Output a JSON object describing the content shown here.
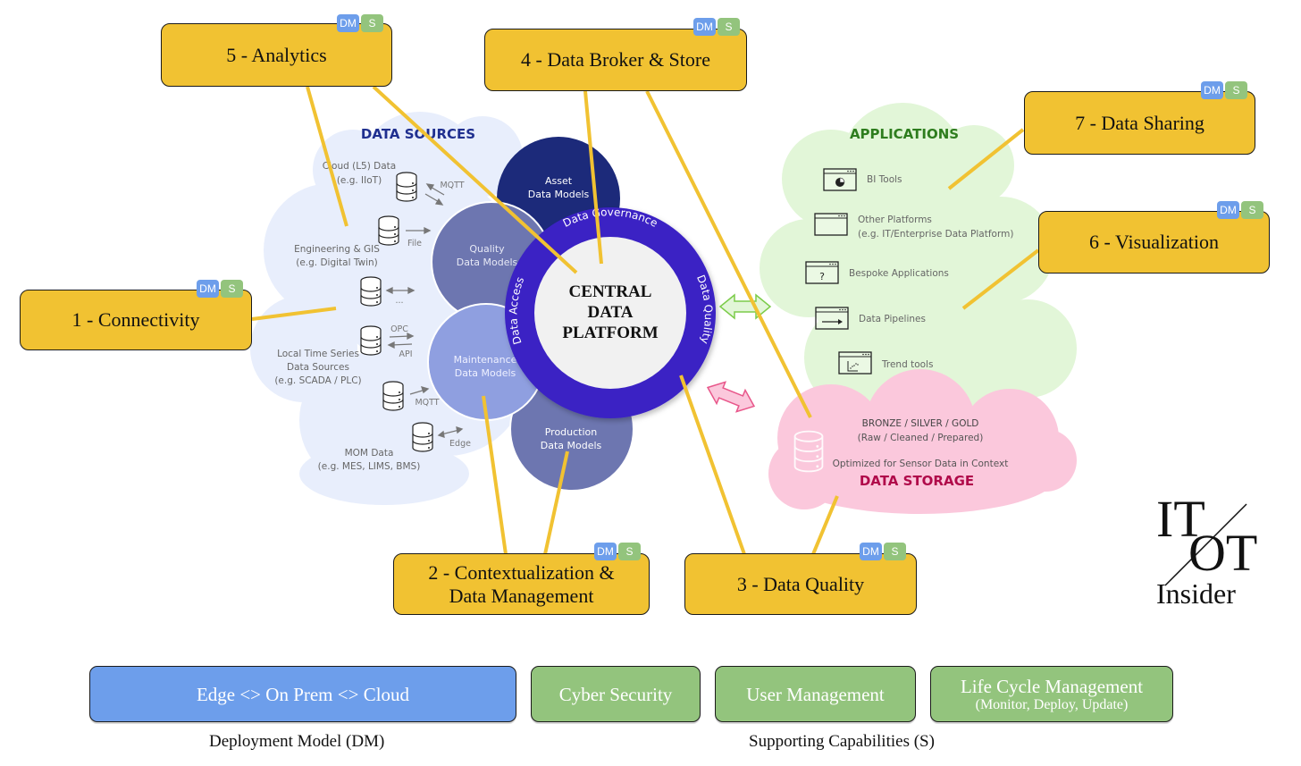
{
  "diagram": {
    "center": {
      "title_lines": [
        "CENTRAL",
        "DATA",
        "PLATFORM"
      ],
      "ring_labels": {
        "top": "Data Governance",
        "left": "Data Access",
        "right": "Data Quality"
      }
    },
    "data_models": [
      {
        "line1": "Asset",
        "line2": "Data Models"
      },
      {
        "line1": "Quality",
        "line2": "Data Models"
      },
      {
        "line1": "Maintenance",
        "line2": "Data Models"
      },
      {
        "line1": "Production",
        "line2": "Data Models"
      }
    ],
    "data_sources": {
      "title": "DATA SOURCES",
      "items": [
        {
          "label_lines": [
            "Cloud (L5) Data",
            "(e.g. IIoT)"
          ],
          "protocol": "MQTT",
          "protocol2": ""
        },
        {
          "label_lines": [
            "Engineering & GIS",
            "(e.g. Digital Twin)"
          ],
          "protocol": "File",
          "protocol2": ""
        },
        {
          "label_lines": [],
          "protocol": "...",
          "protocol2": ""
        },
        {
          "label_lines": [
            "Local Time Series",
            "Data Sources",
            "(e.g. SCADA / PLC)"
          ],
          "protocol": "OPC",
          "protocol2": "API"
        },
        {
          "label_lines": [],
          "protocol": "MQTT",
          "protocol2": ""
        },
        {
          "label_lines": [
            "MOM Data",
            "(e.g. MES, LIMS, BMS)"
          ],
          "protocol": "Edge",
          "protocol2": ""
        }
      ]
    },
    "applications": {
      "title": "APPLICATIONS",
      "items": [
        {
          "label": "BI Tools",
          "sub": "",
          "icon": "pie-chart-window-icon"
        },
        {
          "label": "Other Platforms",
          "sub": "(e.g. IT/Enterprise Data Platform)",
          "icon": "window-icon"
        },
        {
          "label": "Bespoke Applications",
          "sub": "",
          "icon": "question-window-icon"
        },
        {
          "label": "Data Pipelines",
          "sub": "",
          "icon": "arrow-window-icon"
        },
        {
          "label": "Trend tools",
          "sub": "",
          "icon": "scatter-window-icon"
        }
      ]
    },
    "data_storage": {
      "line1": "BRONZE / SILVER / GOLD",
      "line2": "(Raw / Cleaned / Prepared)",
      "line3": "Optimized for Sensor Data in Context",
      "title": "DATA STORAGE"
    },
    "callouts": [
      {
        "id": "connectivity",
        "lines": [
          "1 - Connectivity"
        ]
      },
      {
        "id": "contextualization",
        "lines": [
          "2 - Contextualization &",
          "Data Management"
        ]
      },
      {
        "id": "data-quality",
        "lines": [
          "3 - Data Quality"
        ]
      },
      {
        "id": "data-broker",
        "lines": [
          "4 - Data Broker & Store"
        ]
      },
      {
        "id": "analytics",
        "lines": [
          "5 - Analytics"
        ]
      },
      {
        "id": "visualization",
        "lines": [
          "6 - Visualization"
        ]
      },
      {
        "id": "data-sharing",
        "lines": [
          "7 - Data Sharing"
        ]
      }
    ],
    "tags": {
      "dm": "DM",
      "s": "S"
    }
  },
  "legend": {
    "deployment": {
      "label": "Edge <> On Prem <> Cloud",
      "caption": "Deployment Model (DM)"
    },
    "capabilities": [
      {
        "label": "Cyber Security",
        "sub": ""
      },
      {
        "label": "User Management",
        "sub": ""
      },
      {
        "label": "Life Cycle Management",
        "sub": "(Monitor, Deploy, Update)"
      }
    ],
    "capabilities_caption": "Supporting Capabilities (S)"
  },
  "logo": {
    "top": "IT",
    "bottom": "OT",
    "word": "Insider"
  },
  "colors": {
    "callout": "#f1c232",
    "connector": "#f1c232",
    "dm_tag": "#6d9eeb",
    "s_tag": "#93c47d",
    "ring": "#3a22c4",
    "asset_circle": "#1c2a7a",
    "model_circle": "#6d76b0",
    "maintenance_circle": "#8f9fe0",
    "sources_cloud": "#e8eefc",
    "apps_cloud": "#e2f6d8",
    "storage_cloud": "#fbc8dc",
    "sources_title": "#1f2f8f",
    "apps_title": "#2e7d1e",
    "storage_title": "#b00a4a"
  }
}
